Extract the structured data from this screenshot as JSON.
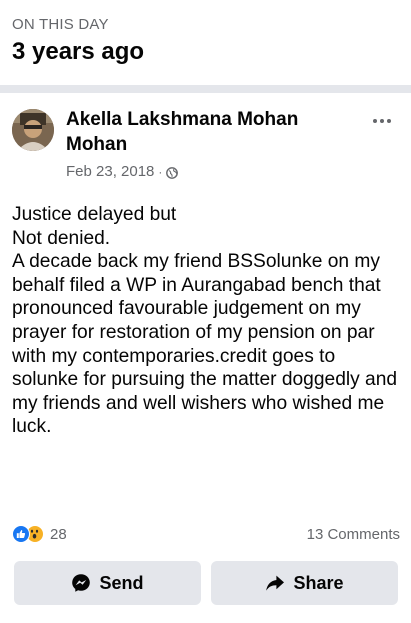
{
  "memory": {
    "kicker": "ON THIS DAY",
    "title": "3 years ago"
  },
  "post": {
    "author": "Akella Lakshmana Mohan Mohan",
    "date": "Feb 23, 2018",
    "separator": "·",
    "privacy_icon": "globe-icon",
    "lines": [
      "Justice delayed but",
      "Not denied.",
      "A decade back my friend BSSolunke on my behalf filed a WP in Aurangabad bench that pronounced favourable judgement on my prayer for restoration of my pension on par with my contemporaries.credit goes to solunke for pursuing the matter doggedly and my friends and well wishers who wished me luck."
    ]
  },
  "stats": {
    "reaction_count": "28",
    "reaction_icons": [
      "like-icon",
      "wow-icon"
    ],
    "comments": "13 Comments"
  },
  "actions": {
    "send_label": "Send",
    "share_label": "Share"
  },
  "colors": {
    "divider": "#e4e6eb",
    "button_bg": "#e4e6eb",
    "secondary_text": "#65676b",
    "like_blue": "#1877f2",
    "wow_yellow": "#f7b125"
  }
}
